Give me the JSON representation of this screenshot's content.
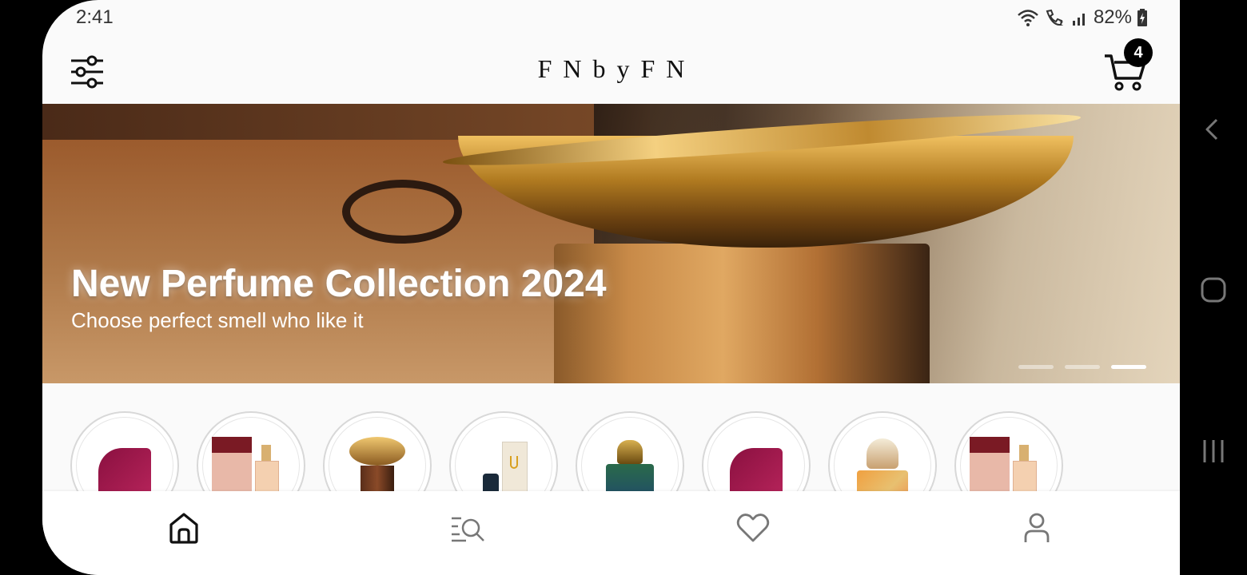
{
  "status_bar": {
    "time": "2:41",
    "battery": "82%",
    "icons": [
      "wifi-icon",
      "wifi-calling-icon",
      "signal-icon",
      "battery-charging-icon"
    ]
  },
  "app_bar": {
    "brand": "FNbyFN",
    "cart_count": "4",
    "left_icon": "filter-sliders-icon",
    "right_icon": "cart-icon"
  },
  "banner": {
    "title": "New Perfume Collection 2024",
    "subtitle": "Choose perfect smell who like it",
    "slides": 3,
    "active_slide": 3
  },
  "products": {
    "items": [
      "product-1",
      "product-2",
      "product-3",
      "product-4",
      "product-5",
      "product-6",
      "product-7",
      "product-8"
    ]
  },
  "bottom_nav": {
    "items": [
      "home-icon",
      "search-list-icon",
      "heart-icon",
      "profile-icon"
    ],
    "active": "home-icon"
  },
  "system_nav": {
    "items": [
      "back-icon",
      "home-button-icon",
      "recents-icon"
    ]
  },
  "colors": {
    "accent": "#000000",
    "background": "#fafafa"
  }
}
